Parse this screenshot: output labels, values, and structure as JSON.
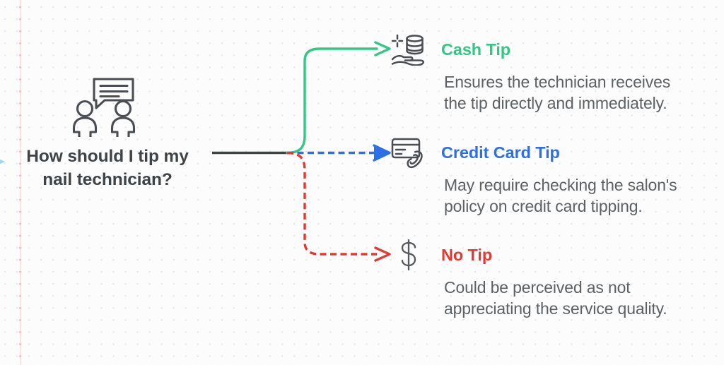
{
  "canvas": {
    "background_color": "#fcfcfc",
    "grid_dot_color": "#e8e8ea",
    "guide_line_color": "#fbd9d6"
  },
  "root": {
    "icon": "two-people-conversation-icon",
    "question": "How should I tip my nail technician?",
    "question_line_1": "How should I tip my",
    "question_line_2": "nail technician?",
    "text_color": "#3f4346"
  },
  "incoming_arrow": {
    "icon": "incoming-arrow-icon",
    "color": "#9ed8f2"
  },
  "trunk": {
    "color": "#3f4346"
  },
  "branches": [
    {
      "id": "cash",
      "icon": "hand-holding-coins-icon",
      "title": "Cash Tip",
      "description": "Ensures the technician receives the tip directly and immediately.",
      "color": "#34c783",
      "line_style": "solid",
      "connector": "curve-up"
    },
    {
      "id": "credit",
      "icon": "credit-card-phone-icon",
      "title": "Credit Card Tip",
      "description": "May require checking the salon's policy on credit card tipping.",
      "color": "#2b70e8",
      "line_style": "dashed",
      "connector": "straight"
    },
    {
      "id": "notip",
      "icon": "dollar-sign-icon",
      "title": "No Tip",
      "description": "Could be perceived as not appreciating the service quality.",
      "color": "#e03a32",
      "line_style": "dashed",
      "connector": "curve-down"
    }
  ]
}
